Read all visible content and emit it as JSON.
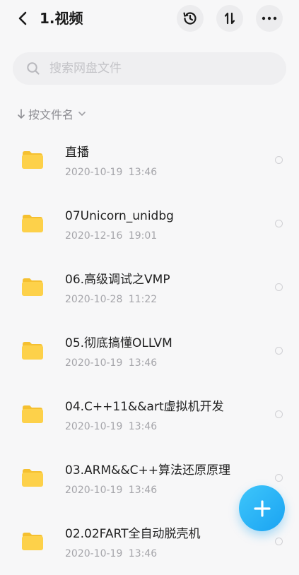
{
  "header": {
    "title": "1.视频"
  },
  "search": {
    "placeholder": "搜索网盘文件"
  },
  "sort": {
    "label": "按文件名"
  },
  "colors": {
    "folder": "#fdd14a",
    "folder_tab": "#f5c030",
    "accent": "#1aa3f2"
  },
  "files": [
    {
      "name": "直播",
      "date": "2020-10-19 13:46"
    },
    {
      "name": "07Unicorn_unidbg",
      "date": "2020-12-16 19:01"
    },
    {
      "name": "06.高级调试之VMP",
      "date": "2020-10-28 11:22"
    },
    {
      "name": "05.彻底搞懂OLLVM",
      "date": "2020-10-19 13:46"
    },
    {
      "name": "04.C++11&&art虚拟机开发",
      "date": "2020-10-19 13:46"
    },
    {
      "name": "03.ARM&&C++算法还原原理",
      "date": "2020-10-19 13:46"
    },
    {
      "name": "02.02FART全自动脱壳机",
      "date": "2020-10-19 13:46"
    }
  ]
}
